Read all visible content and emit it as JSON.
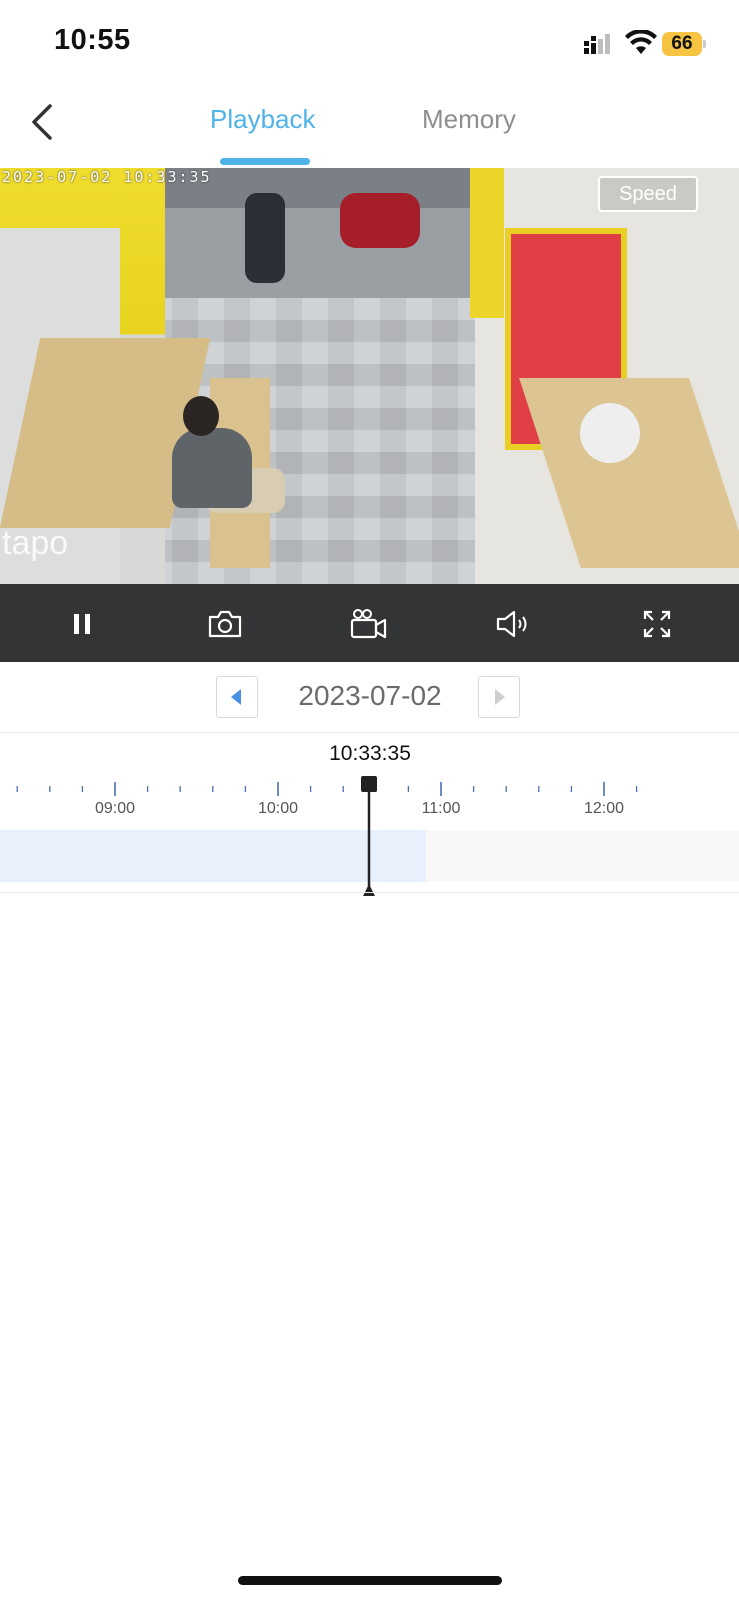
{
  "status_bar": {
    "time": "10:55",
    "battery": "66"
  },
  "nav": {
    "tabs": [
      {
        "label": "Playback",
        "active": true
      },
      {
        "label": "Memory",
        "active": false
      }
    ]
  },
  "video": {
    "timestamp": "2023-07-02 10:33:35",
    "logo": "tapo",
    "speed_label": "Speed"
  },
  "controls": {
    "icons": [
      "pause-icon",
      "camera-icon",
      "record-icon",
      "speaker-icon",
      "fullscreen-icon"
    ]
  },
  "date_selector": {
    "date": "2023-07-02"
  },
  "timeline": {
    "current_time": "10:33:35",
    "labels": [
      "09:00",
      "10:00",
      "11:00",
      "12:00"
    ],
    "recorded_until": "11:00"
  },
  "colors": {
    "accent": "#4fb3e8",
    "control_bar": "#333436",
    "recorded_band": "#e8f0fc"
  }
}
